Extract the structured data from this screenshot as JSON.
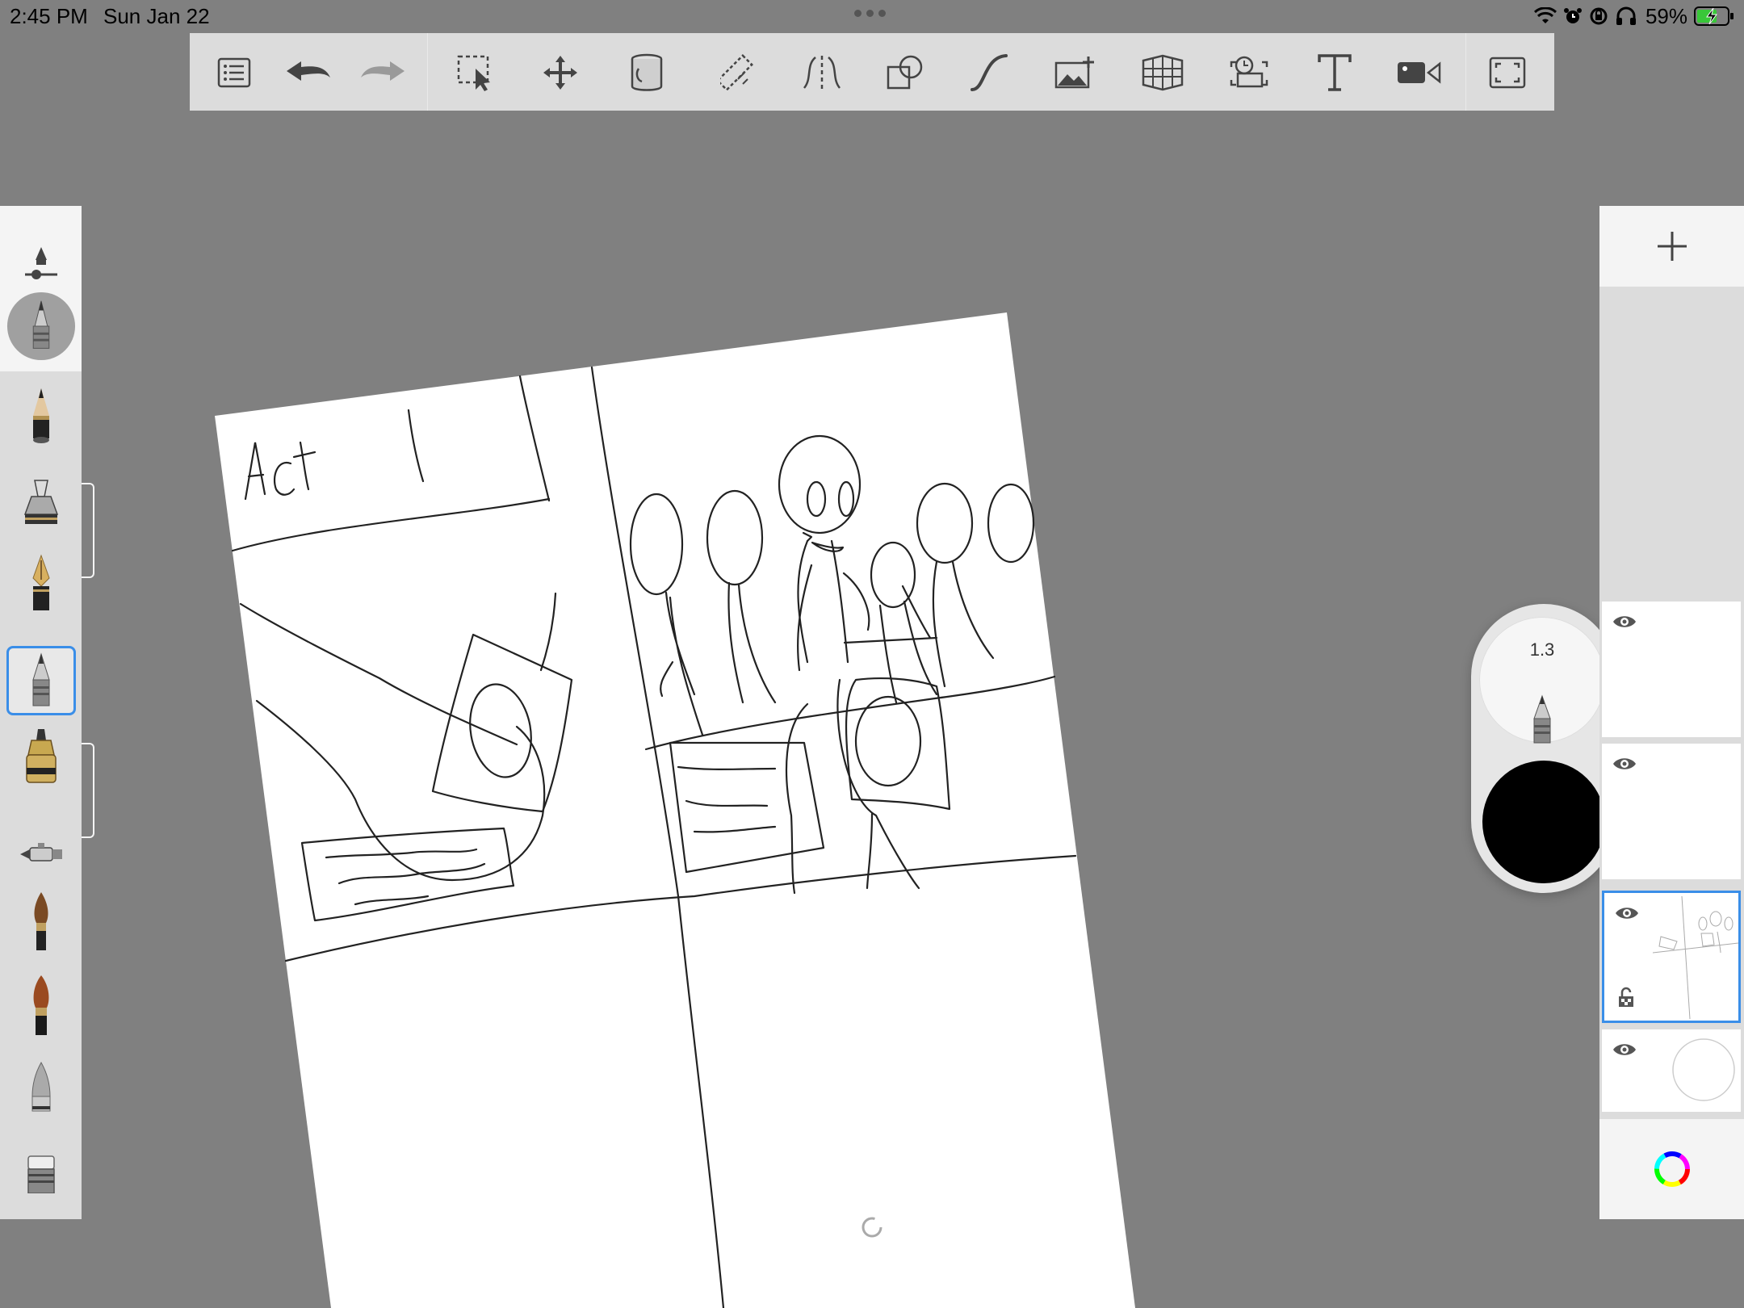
{
  "status_bar": {
    "time": "2:45 PM",
    "date": "Sun Jan 22",
    "battery_percent": "59%"
  },
  "toolbar": {
    "items": [
      {
        "name": "layers-list-icon"
      },
      {
        "name": "undo-icon"
      },
      {
        "name": "redo-icon"
      },
      {
        "name": "selection-icon"
      },
      {
        "name": "transform-icon"
      },
      {
        "name": "fill-bucket-icon"
      },
      {
        "name": "ruler-icon"
      },
      {
        "name": "symmetry-icon"
      },
      {
        "name": "shape-icon"
      },
      {
        "name": "curve-icon"
      },
      {
        "name": "import-image-icon"
      },
      {
        "name": "perspective-grid-icon"
      },
      {
        "name": "time-lapse-icon"
      },
      {
        "name": "text-icon"
      },
      {
        "name": "video-icon"
      },
      {
        "name": "fullscreen-icon"
      }
    ]
  },
  "canvas": {
    "text_act": "Act",
    "text_one": "1"
  },
  "brush": {
    "size": "1.3",
    "color": "#000000",
    "selected_index": 3
  },
  "layers": [
    {
      "name": "layer-4",
      "visible": true,
      "selected": false
    },
    {
      "name": "layer-3",
      "visible": true,
      "selected": false
    },
    {
      "name": "layer-2",
      "visible": true,
      "selected": true,
      "locked": true
    },
    {
      "name": "background",
      "visible": true,
      "selected": false
    }
  ],
  "colors": {
    "accent": "#3a8ee8",
    "background": "#808080",
    "panel": "#dcdcdc"
  }
}
